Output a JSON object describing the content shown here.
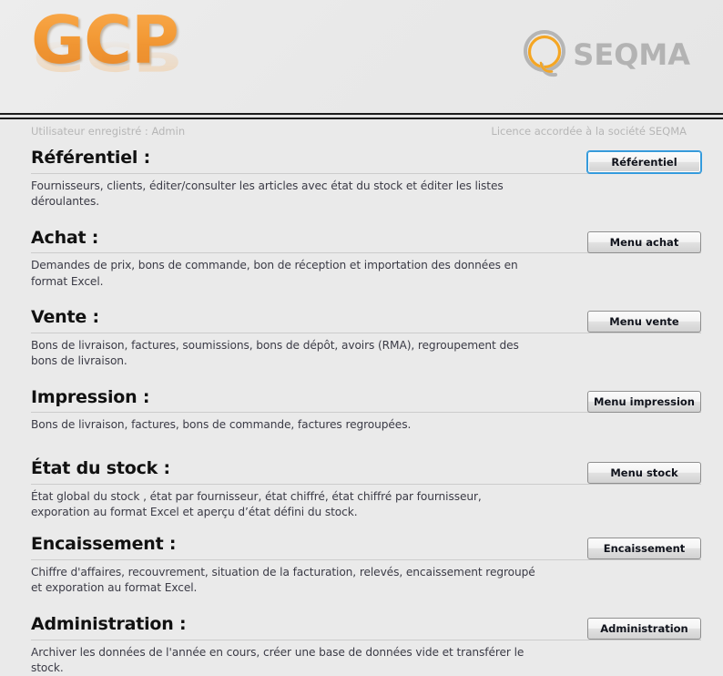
{
  "header": {
    "app_logo_text": "GCP",
    "company_logo_text": "SEQMA",
    "logo_accent_color": "#f39a36",
    "company_gray_color": "#b3b3b3"
  },
  "statusbar": {
    "user_label": "Utilisateur enregistré : Admin",
    "licence_label": "Licence accordée à la société SEQMA"
  },
  "sections": [
    {
      "title": "Référentiel :",
      "description": "Fournisseurs, clients, éditer/consulter les articles avec état du stock et éditer les listes déroulantes.",
      "button_label": "Référentiel",
      "focused": true
    },
    {
      "title": "Achat :",
      "description": "Demandes de prix, bons de commande, bon de réception et importation des données en format Excel.",
      "button_label": "Menu achat",
      "focused": false
    },
    {
      "title": "Vente :",
      "description": "Bons de livraison, factures, soumissions, bons de dépôt, avoirs (RMA), regroupement des bons de livraison.",
      "button_label": "Menu vente",
      "focused": false
    },
    {
      "title": "Impression :",
      "description": "Bons de livraison, factures, bons de commande, factures regroupées.",
      "button_label": "Menu impression",
      "focused": false
    },
    {
      "title": "État du stock :",
      "description": "État global du stock , état par fournisseur, état chiffré, état chiffré par fournisseur, exporation au format Excel et aperçu d’état défini du stock.",
      "button_label": "Menu stock",
      "focused": false
    },
    {
      "title": "Encaissement :",
      "description": "Chiffre d'affaires, recouvrement, situation de la facturation, relevés, encaissement regroupé et exporation au format Excel.",
      "button_label": "Encaissement",
      "focused": false
    },
    {
      "title": "Administration :",
      "description": "Archiver les données de l'année en cours, créer une base de données vide et transférer le stock.",
      "button_label": "Administration",
      "focused": false
    }
  ]
}
